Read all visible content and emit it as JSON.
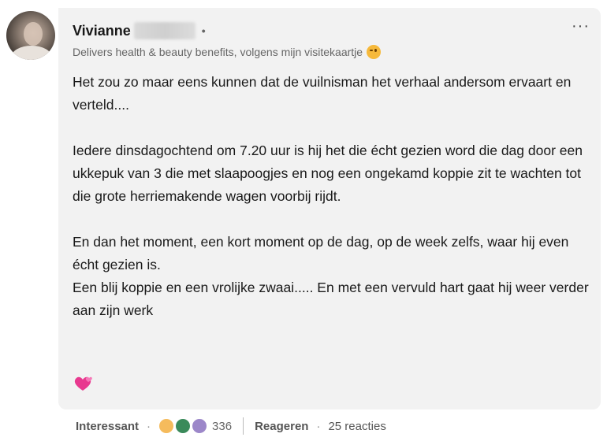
{
  "post": {
    "author_name": "Vivianne",
    "name_separator": "•",
    "headline": "Delivers health & beauty benefits, volgens mijn visitekaartje",
    "more_label": "···",
    "paragraphs": [
      "Het zou zo maar eens kunnen dat de vuilnisman het verhaal andersom ervaart en verteld....",
      "Iedere dinsdagochtend om 7.20 uur is hij het die écht gezien word die dag door een ukkepuk van 3 die met slaapoogjes en nog een ongekamd koppie zit te wachten tot die grote herriemakende wagen voorbij rijdt.",
      "En dan het moment, een kort moment op de dag, op de week zelfs, waar hij even écht gezien is.",
      "Een blij koppie en een vrolijke zwaai..... En met een vervuld hart gaat hij weer verder aan zijn werk"
    ]
  },
  "footer": {
    "reaction_label": "Interessant",
    "dot": "·",
    "reaction_icons": [
      "bulb-icon",
      "support-icon",
      "insight-icon"
    ],
    "reaction_count": "336",
    "reply_label": "Reageren",
    "reply_count": "25 reacties"
  },
  "colors": {
    "bubble": "#f2f2f2",
    "text": "#191919",
    "muted": "#666666"
  }
}
